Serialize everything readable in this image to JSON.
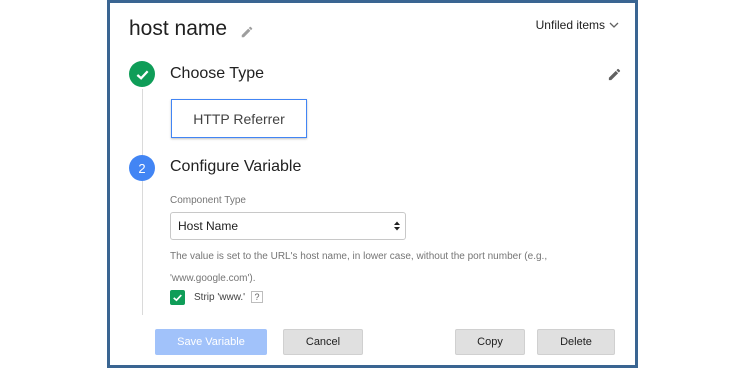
{
  "header": {
    "title": "host name",
    "folder": "Unfiled items"
  },
  "step1": {
    "title": "Choose Type",
    "selected_type": "HTTP Referrer",
    "status": "complete"
  },
  "step2": {
    "number": "2",
    "title": "Configure Variable",
    "component_type_label": "Component Type",
    "component_type_value": "Host Name",
    "help_text_line1": "The value is set to the URL's host name, in lower case, without the port number (e.g.,",
    "help_text_line2": "'www.google.com').",
    "strip_label": "Strip 'www.'",
    "strip_checked": true,
    "help_icon": "?"
  },
  "buttons": {
    "save": "Save Variable",
    "cancel": "Cancel",
    "copy": "Copy",
    "delete": "Delete"
  },
  "colors": {
    "frame_border": "#3a6592",
    "step_complete": "#0f9d58",
    "step_active": "#4285f4",
    "save_disabled": "#a1c2fa"
  }
}
